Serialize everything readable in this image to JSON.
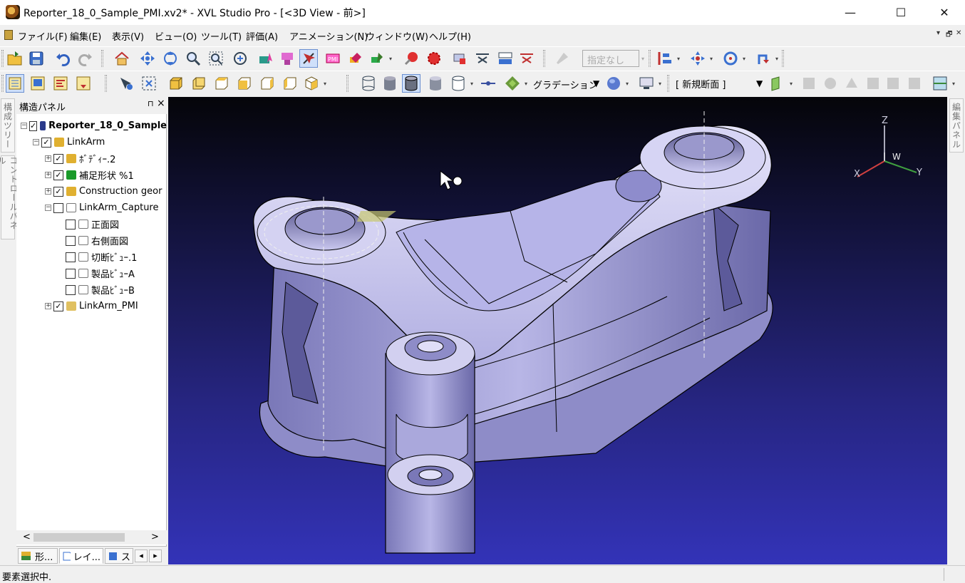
{
  "window": {
    "title": "Reporter_18_0_Sample_PMI.xv2* - XVL Studio Pro - [<3D View - 前>]",
    "minimize": "—",
    "maximize": "☐",
    "close": "✕"
  },
  "menu": [
    "ファイル(F)",
    "編集(E)",
    "表示(V)",
    "ビュー(O)",
    "ツール(T)",
    "評価(A)",
    "アニメーション(N)",
    "ウィンドウ(W)",
    "ヘルプ(H)"
  ],
  "mdi_buttons": [
    "▾",
    "🗗",
    "✕"
  ],
  "toolbar1": {
    "combo_label": "指定なし"
  },
  "toolbar2": {
    "shading_label": "グラデーション",
    "section_combo": "[ 新規断面 ]"
  },
  "left_tabs": [
    "構成ツリー",
    "コントロールパネル"
  ],
  "right_tabs": [
    "編集パネル"
  ],
  "structure_panel": {
    "title": "構造パネル",
    "pin": "⊓",
    "close": "×",
    "tree": [
      {
        "label": "Reporter_18_0_Sample",
        "level": 0,
        "expander": "−",
        "checked": true,
        "icon": "xvl-file-icon",
        "bold": true
      },
      {
        "label": "LinkArm",
        "level": 1,
        "expander": "−",
        "checked": true,
        "icon": "assembly-icon"
      },
      {
        "label": "ﾎﾞﾃﾞｨｰ.2",
        "level": 2,
        "expander": "+",
        "checked": true,
        "icon": "body-icon"
      },
      {
        "label": "補足形状 %1",
        "level": 2,
        "expander": "+",
        "checked": true,
        "icon": "folder-green-icon"
      },
      {
        "label": "Construction geor",
        "level": 2,
        "expander": "+",
        "checked": true,
        "icon": "body-icon"
      },
      {
        "label": "LinkArm_Capture",
        "level": 2,
        "expander": "−",
        "checked": false,
        "icon": "capture-icon"
      },
      {
        "label": "正面図",
        "level": 3,
        "expander": "",
        "checked": false,
        "icon": "capture-icon"
      },
      {
        "label": "右側面図",
        "level": 3,
        "expander": "",
        "checked": false,
        "icon": "capture-icon"
      },
      {
        "label": "切断ﾋﾞｭｰ.1",
        "level": 3,
        "expander": "",
        "checked": false,
        "icon": "capture-icon"
      },
      {
        "label": "製品ﾋﾞｭｰA",
        "level": 3,
        "expander": "",
        "checked": false,
        "icon": "capture-icon"
      },
      {
        "label": "製品ﾋﾞｭｰB",
        "level": 3,
        "expander": "",
        "checked": false,
        "icon": "capture-icon"
      },
      {
        "label": "LinkArm_PMI",
        "level": 2,
        "expander": "+",
        "checked": true,
        "icon": "pmi-icon"
      }
    ],
    "scroll_left": "<",
    "scroll_right": ">",
    "bottom_tabs": [
      "形...",
      "レイ...",
      "ス"
    ],
    "tab_nav": [
      "◂",
      "▸"
    ]
  },
  "viewport": {
    "axis_labels": {
      "z": "Z",
      "x": "X",
      "y": "Y",
      "w": "W"
    }
  },
  "status": {
    "text": "要素選択中."
  },
  "colors": {
    "viewport_top": "#050509",
    "viewport_bottom": "#3333b8",
    "part_light": "#c4c2ec",
    "part_dark": "#4a4890"
  }
}
